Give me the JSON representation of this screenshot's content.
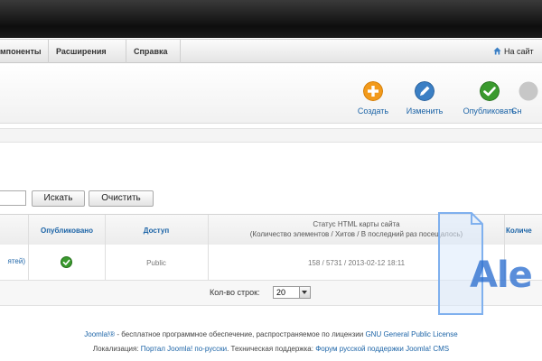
{
  "menu": {
    "items": [
      "мпоненты",
      "Расширения",
      "Справка"
    ],
    "site_link": "На сайт"
  },
  "toolbar": {
    "buttons": [
      {
        "label": "Создать",
        "icon": "plus-icon",
        "color": "#f29a1b"
      },
      {
        "label": "Изменить",
        "icon": "pencil-icon",
        "color": "#3b7fc4"
      },
      {
        "label": "Опубликовать",
        "icon": "check-icon",
        "color": "#3a9a2e"
      },
      {
        "label": "Сн"
      }
    ]
  },
  "filter": {
    "search_label": "Искать",
    "clear_label": "Очистить"
  },
  "table": {
    "headers": {
      "published": "Опубликовано",
      "access": "Доступ",
      "status_line1": "Статус HTML карты сайта",
      "status_line2": "(Количество элементов / Хитов / В последний раз посещалось)",
      "quantity": "Количе"
    },
    "rows": [
      {
        "title_fragment": "ятей)",
        "published": true,
        "access": "Public",
        "status": "158 / 5731 / 2013-02-12 18:11"
      }
    ]
  },
  "pager": {
    "label": "Кол-во строк:",
    "value": "20"
  },
  "footer": {
    "line1_brand": "Joomla!®",
    "line1_text": " - бесплатное программное обеспечение, распространяемое по лицензии ",
    "line1_license": "GNU General Public License",
    "line2_label": "Локализация: ",
    "line2_portal": "Портал Joomla! по-русски",
    "line2_sep": ". Техническая поддержка: ",
    "line2_forum": "Форум русской поддержки Joomla! CMS"
  },
  "watermark": {
    "text": "Ale"
  }
}
